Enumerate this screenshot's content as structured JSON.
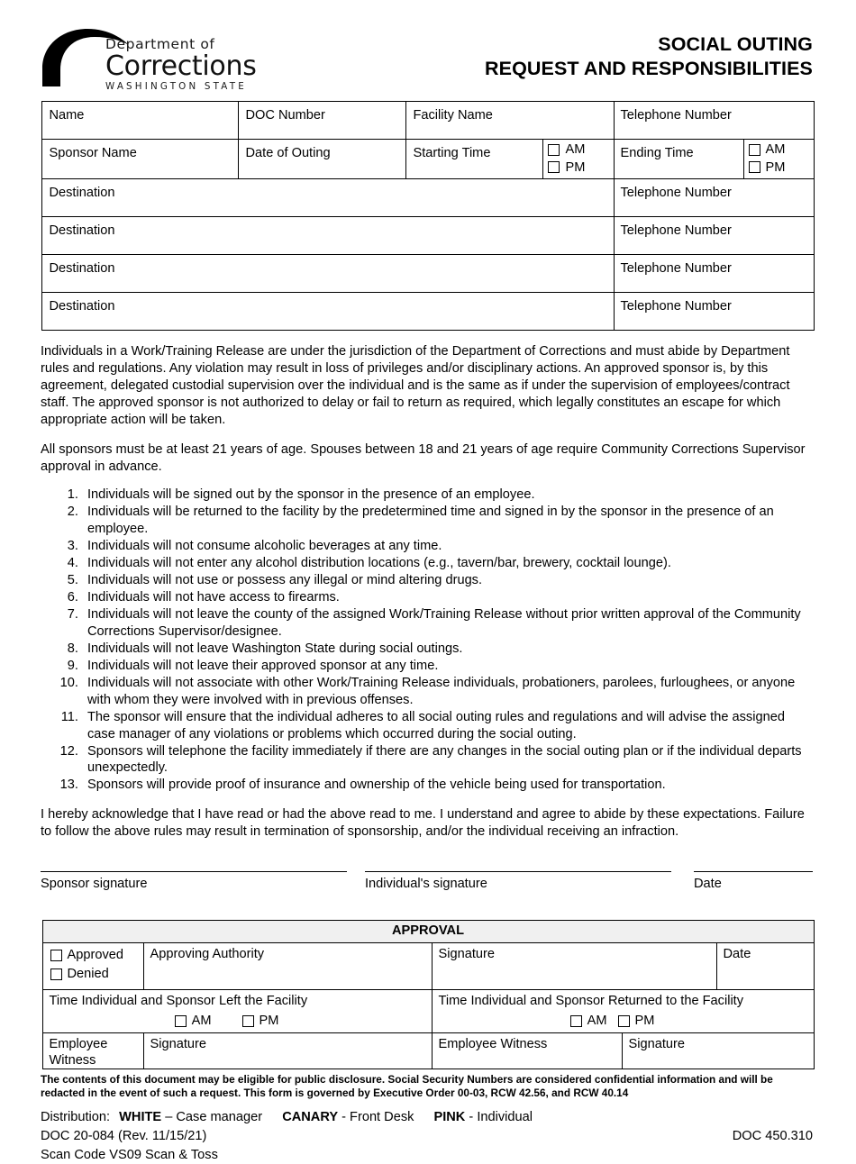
{
  "header": {
    "logo": {
      "dept_line": "Department of",
      "name_line": "Corrections",
      "state_line": "WASHINGTON STATE",
      "icon": "doc-arch-logo"
    },
    "title_line1": "SOCIAL OUTING",
    "title_line2": "REQUEST AND RESPONSIBILITIES"
  },
  "info_table": {
    "row1": {
      "name": "Name",
      "doc_number": "DOC Number",
      "facility_name": "Facility Name",
      "telephone_number": "Telephone Number"
    },
    "row2": {
      "sponsor_name": "Sponsor Name",
      "date_of_outing": "Date of Outing",
      "starting_time": "Starting Time",
      "start_am": "AM",
      "start_pm": "PM",
      "ending_time": "Ending Time",
      "end_am": "AM",
      "end_pm": "PM"
    },
    "destinations": [
      {
        "destination": "Destination",
        "telephone": "Telephone Number"
      },
      {
        "destination": "Destination",
        "telephone": "Telephone Number"
      },
      {
        "destination": "Destination",
        "telephone": "Telephone Number"
      },
      {
        "destination": "Destination",
        "telephone": "Telephone Number"
      }
    ]
  },
  "paragraphs": {
    "jurisdiction": "Individuals in a Work/Training Release are under the jurisdiction of the Department of Corrections and must abide by Department rules and regulations.  Any violation may result in loss of privileges and/or disciplinary actions.  An approved sponsor is, by this agreement, delegated custodial supervision over the individual and is the same as if under the supervision of employees/contract staff.  The approved sponsor is not authorized to delay or fail to return as required, which legally constitutes an escape for which appropriate action will be taken.",
    "age_requirement": "All sponsors must be at least 21 years of age.  Spouses between 18 and 21 years of age require Community Corrections Supervisor approval in advance.",
    "acknowledgement": "I hereby acknowledge that I have read or had the above read to me.  I understand and agree to abide by these expectations.  Failure to follow the above rules may result in termination of sponsorship, and/or the individual receiving an infraction."
  },
  "rules": [
    "Individuals will be signed out by the sponsor in the presence of an employee.",
    "Individuals will be returned to the facility by the predetermined time and signed in by the sponsor in the presence of an employee.",
    "Individuals will not consume alcoholic beverages at any time.",
    "Individuals will not enter any alcohol distribution locations (e.g., tavern/bar, brewery, cocktail lounge).",
    "Individuals will not use or possess any illegal or mind altering drugs.",
    "Individuals will not have access to firearms.",
    "Individuals will not leave the county of the assigned Work/Training Release without prior written approval of the Community Corrections Supervisor/designee.",
    "Individuals will not leave Washington State during social outings.",
    "Individuals will not leave their approved sponsor at any time.",
    "Individuals will not associate with other Work/Training Release individuals, probationers, parolees, furloughees, or anyone with whom they were involved with in previous offenses.",
    "The sponsor will ensure that the individual adheres to all social outing rules and regulations and will advise the assigned case manager of any violations or problems which occurred during the social outing.",
    "Sponsors will telephone the facility immediately if there are any changes in the social outing plan or if the individual departs unexpectedly.",
    "Sponsors will provide proof of insurance and ownership of the vehicle being used for transportation."
  ],
  "signatures": {
    "sponsor_signature": "Sponsor signature",
    "individual_signature": "Individual's signature",
    "date": "Date"
  },
  "approval": {
    "heading": "APPROVAL",
    "approved": "Approved",
    "denied": "Denied",
    "approving_authority": "Approving Authority",
    "signature": "Signature",
    "date": "Date",
    "time_left": "Time Individual and Sponsor Left the Facility",
    "time_left_am": "AM",
    "time_left_pm": "PM",
    "time_returned": "Time Individual and Sponsor Returned to the Facility",
    "time_returned_am": "AM",
    "time_returned_pm": "PM",
    "employee_witness_left": "Employee Witness",
    "signature_left": "Signature",
    "employee_witness_returned": "Employee Witness",
    "signature_returned": "Signature"
  },
  "footer": {
    "disclaimer": "The contents of this document may be eligible for public disclosure.  Social Security Numbers are considered confidential information and will be redacted in the event of such a request.  This form is governed by Executive Order 00-03, RCW 42.56, and RCW 40.14",
    "distribution_label": "Distribution:",
    "white": "WHITE",
    "white_desc": "– Case manager",
    "canary": "CANARY",
    "canary_desc": "- Front Desk",
    "pink": "PINK",
    "pink_desc": "- Individual",
    "form_number": "DOC 20-084 (Rev. 11/15/21)",
    "policy_number": "DOC 450.310",
    "scan_code": "Scan Code VS09 Scan & Toss"
  }
}
